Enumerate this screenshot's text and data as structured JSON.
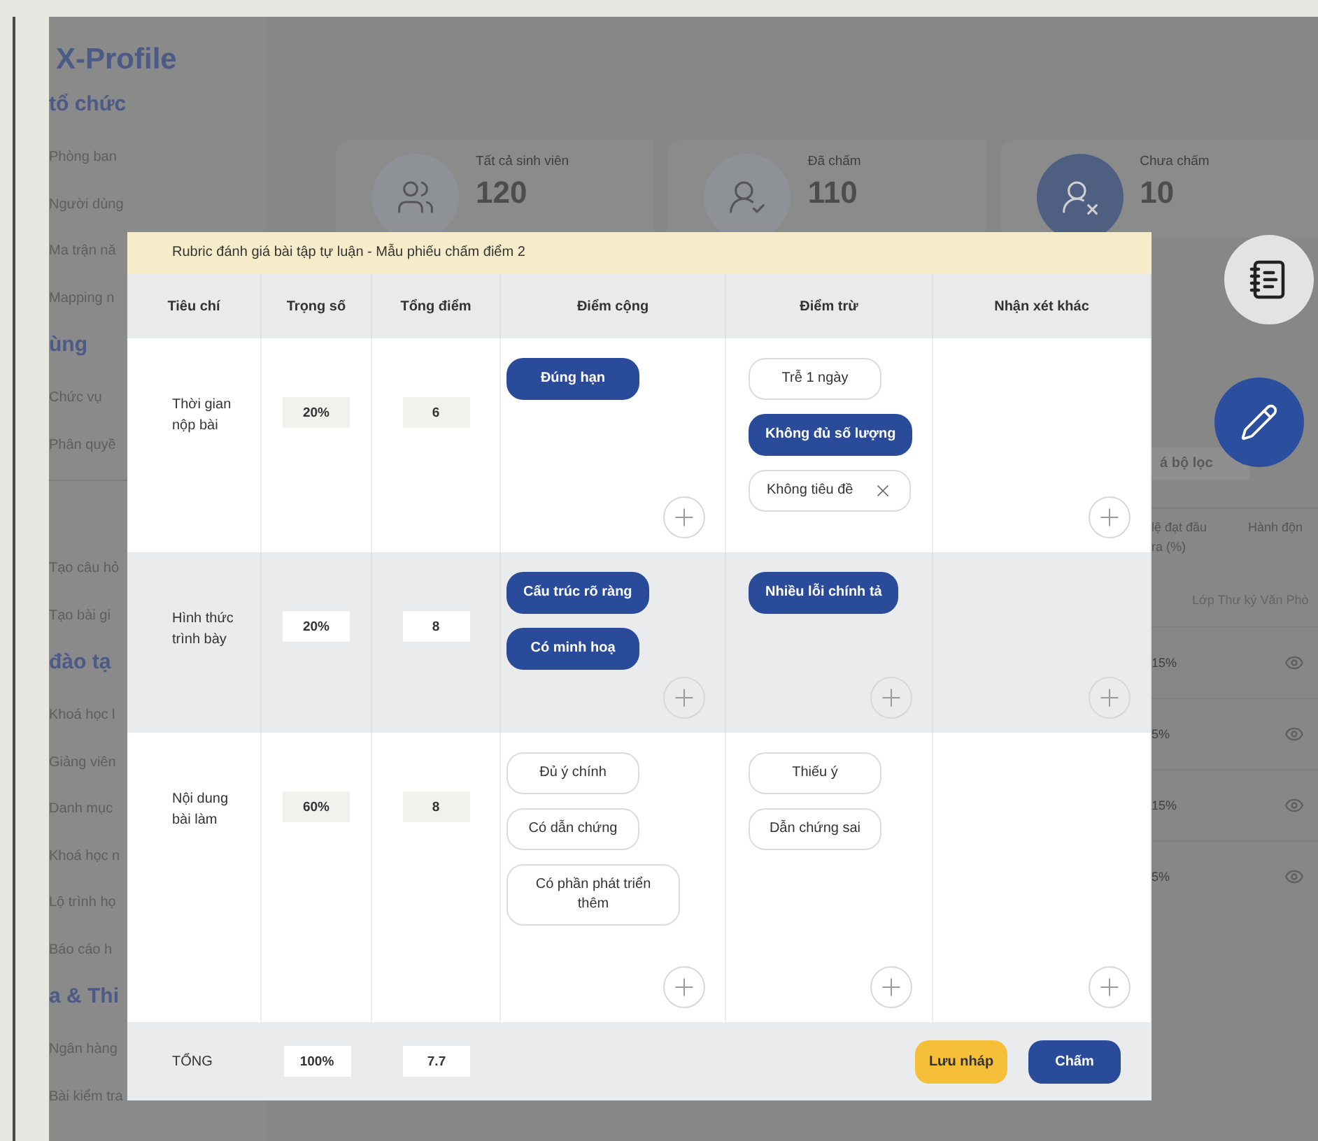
{
  "background": {
    "brand": "X-Profile",
    "sidebar": [
      {
        "kind": "heading",
        "label": "tổ chức"
      },
      {
        "kind": "item",
        "label": "Phòng ban"
      },
      {
        "kind": "item",
        "label": "Người dùng"
      },
      {
        "kind": "item",
        "label": "Ma trận nă"
      },
      {
        "kind": "item",
        "label": "Mapping n"
      },
      {
        "kind": "heading",
        "label": "ùng"
      },
      {
        "kind": "item",
        "label": "Chức vụ"
      },
      {
        "kind": "item",
        "label": "Phân quyề"
      },
      {
        "kind": "divider"
      },
      {
        "kind": "item",
        "label": "Tạo câu hỏ"
      },
      {
        "kind": "item",
        "label": "Tạo bài gi"
      },
      {
        "kind": "heading",
        "label": "đào tạ"
      },
      {
        "kind": "item",
        "label": "Khoá học l"
      },
      {
        "kind": "item",
        "label": "Giảng viên"
      },
      {
        "kind": "item",
        "label": "Danh mục"
      },
      {
        "kind": "item",
        "label": "Khoá học n"
      },
      {
        "kind": "item",
        "label": "Lộ trình họ"
      },
      {
        "kind": "item",
        "label": "Báo cáo h"
      },
      {
        "kind": "heading",
        "label": "a & Thi"
      },
      {
        "kind": "item",
        "label": "Ngân hàng"
      },
      {
        "kind": "item",
        "label": "Bài kiểm tra"
      }
    ],
    "stats": [
      {
        "kind": "all",
        "label": "Tất cả sinh viên",
        "value": "120",
        "selected": false
      },
      {
        "kind": "graded",
        "label": "Đã chấm",
        "value": "110",
        "selected": false
      },
      {
        "kind": "ungraded",
        "label": "Chưa chấm",
        "value": "10",
        "selected": true
      }
    ],
    "filter_button": "á bộ lọc",
    "table_columns": [
      "lệ đạt đầu ra (%)",
      "Hành độn"
    ],
    "group_label": "Lớp Thư ký Văn Phò",
    "rows": [
      {
        "rate": "15%"
      },
      {
        "rate": "5%"
      },
      {
        "rate": "15%"
      },
      {
        "rate": "5%"
      }
    ]
  },
  "modal": {
    "title": "Rubric đánh giá bài tập tự luận - Mẫu phiếu chấm điểm 2",
    "columns": [
      "Tiêu chí",
      "Trọng số",
      "Tổng điểm",
      "Điểm cộng",
      "Điểm trừ",
      "Nhận xét khác"
    ],
    "criteria": [
      {
        "name": "Thời gian nộp bài",
        "weight": "20%",
        "score": "6",
        "bonus": {
          "chips": [
            {
              "label": "Đúng hạn",
              "selected": true,
              "removable": false
            }
          ],
          "add_button": true
        },
        "penalty": {
          "chips": [
            {
              "label": "Trễ 1 ngày",
              "selected": false,
              "removable": false
            },
            {
              "label": "Không đủ số lượng",
              "selected": true,
              "removable": false
            },
            {
              "label": "Không tiêu đề",
              "selected": false,
              "removable": true
            }
          ],
          "add_button": false
        },
        "other": {
          "add_button": true
        }
      },
      {
        "name": "Hình thức trình bày",
        "weight": "20%",
        "score": "8",
        "bonus": {
          "chips": [
            {
              "label": "Cấu trúc rõ ràng",
              "selected": true,
              "removable": false
            },
            {
              "label": "Có minh hoạ",
              "selected": true,
              "removable": false
            }
          ],
          "add_button": true
        },
        "penalty": {
          "chips": [
            {
              "label": "Nhiều lỗi chính tả",
              "selected": true,
              "removable": false
            }
          ],
          "add_button": true
        },
        "other": {
          "add_button": true
        }
      },
      {
        "name": "Nội dung bài làm",
        "weight": "60%",
        "score": "8",
        "bonus": {
          "chips": [
            {
              "label": "Đủ ý chính",
              "selected": false,
              "removable": false
            },
            {
              "label": "Có dẫn chứng",
              "selected": false,
              "removable": false
            },
            {
              "label": "Có phần phát triển thêm",
              "selected": false,
              "removable": false
            }
          ],
          "add_button": true
        },
        "penalty": {
          "chips": [
            {
              "label": "Thiếu ý",
              "selected": false,
              "removable": false
            },
            {
              "label": "Dẫn chứng sai",
              "selected": false,
              "removable": false
            }
          ],
          "add_button": true
        },
        "other": {
          "add_button": true
        }
      }
    ],
    "total": {
      "label": "TỔNG",
      "weight": "100%",
      "score": "7.7"
    },
    "buttons": [
      {
        "kind": "draft",
        "label": "Lưu nháp"
      },
      {
        "kind": "primary",
        "label": "Chấm"
      }
    ]
  }
}
